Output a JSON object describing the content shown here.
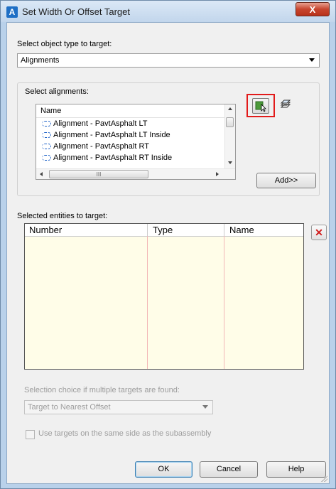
{
  "window": {
    "title": "Set Width Or Offset Target",
    "close_label": "X",
    "app_icon_letter": "A"
  },
  "object_type": {
    "label": "Select object type to target:",
    "value": "Alignments"
  },
  "alignments": {
    "group_label": "Select alignments:",
    "column_header": "Name",
    "items": [
      "Alignment - PavtAsphalt LT",
      "Alignment - PavtAsphalt LT Inside",
      "Alignment - PavtAsphalt RT",
      "Alignment - PavtAsphalt RT Inside"
    ],
    "hscroll_thumb_label": "III",
    "add_label": "Add>>"
  },
  "targets": {
    "label": "Selected entities to target:",
    "columns": [
      "Number",
      "Type",
      "Name"
    ],
    "delete_label": "✕"
  },
  "selection_choice": {
    "label": "Selection choice if multiple targets are found:",
    "value": "Target to Nearest Offset"
  },
  "same_side": {
    "label": "Use targets on the same side as the subassembly",
    "checked": false
  },
  "buttons": {
    "ok": "OK",
    "cancel": "Cancel",
    "help": "Help"
  }
}
